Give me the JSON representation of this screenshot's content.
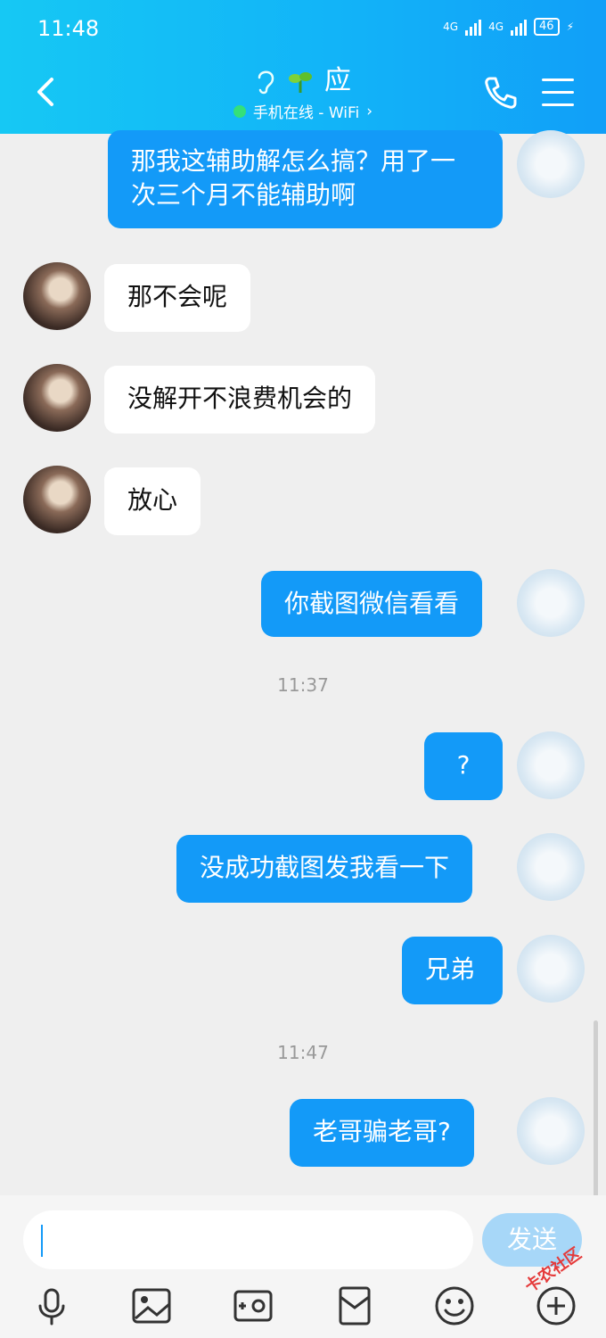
{
  "status": {
    "time": "11:48",
    "net1": "4G",
    "net2": "4G",
    "battery": "46"
  },
  "header": {
    "title": "应",
    "presence": "手机在线 - WiFi",
    "chevron": "›"
  },
  "messages": [
    {
      "from": "me",
      "text": "那我这辅助解怎么搞？用了一次三个月不能辅助啊"
    },
    {
      "from": "them",
      "text": "那不会呢"
    },
    {
      "from": "them",
      "text": "没解开不浪费机会的"
    },
    {
      "from": "them",
      "text": "放心"
    },
    {
      "from": "me",
      "text": "你截图微信看看"
    },
    {
      "from": "me",
      "text": "?"
    },
    {
      "from": "me",
      "text": "没成功截图发我看一下"
    },
    {
      "from": "me",
      "text": "兄弟"
    },
    {
      "from": "me",
      "text": "老哥骗老哥?"
    }
  ],
  "timestamps": [
    "11:37",
    "11:47"
  ],
  "input": {
    "value": "",
    "send_label": "发送"
  },
  "watermark": "卡农社区",
  "icons": [
    "back-arrow-icon",
    "ear-icon",
    "sprout-icon",
    "phone-icon",
    "menu-icon",
    "mic-icon",
    "image-icon",
    "camera-icon",
    "red-packet-icon",
    "emoji-icon",
    "plus-icon"
  ]
}
